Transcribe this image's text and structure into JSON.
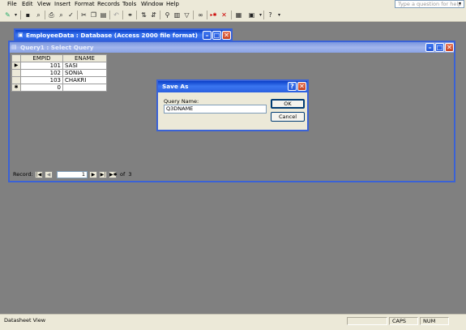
{
  "menu": [
    "File",
    "Edit",
    "View",
    "Insert",
    "Format",
    "Records",
    "Tools",
    "Window",
    "Help"
  ],
  "help_box": {
    "placeholder": "Type a question for help"
  },
  "db_window": {
    "title": "EmployeeData : Database (Access 2000 file format)"
  },
  "query_window": {
    "title": "Query1 : Select Query",
    "columns": [
      "EMPID",
      "ENAME"
    ],
    "rows": [
      {
        "selector": "▶",
        "empid": "101",
        "ename": "SASI"
      },
      {
        "selector": "",
        "empid": "102",
        "ename": "SONIA"
      },
      {
        "selector": "",
        "empid": "103",
        "ename": "CHAKRI"
      },
      {
        "selector": "✱",
        "empid": "0",
        "ename": ""
      }
    ],
    "record_nav": {
      "label": "Record:",
      "current": "1",
      "of_text": "of  3"
    }
  },
  "dialog": {
    "title": "Save As",
    "field_label": "Query Name:",
    "field_value": "Q3DNAME",
    "ok": "OK",
    "cancel": "Cancel",
    "help_btn": "?",
    "close_btn": "✕"
  },
  "status": {
    "left": "Datasheet View",
    "caps": "CAPS",
    "num": "NUM"
  }
}
